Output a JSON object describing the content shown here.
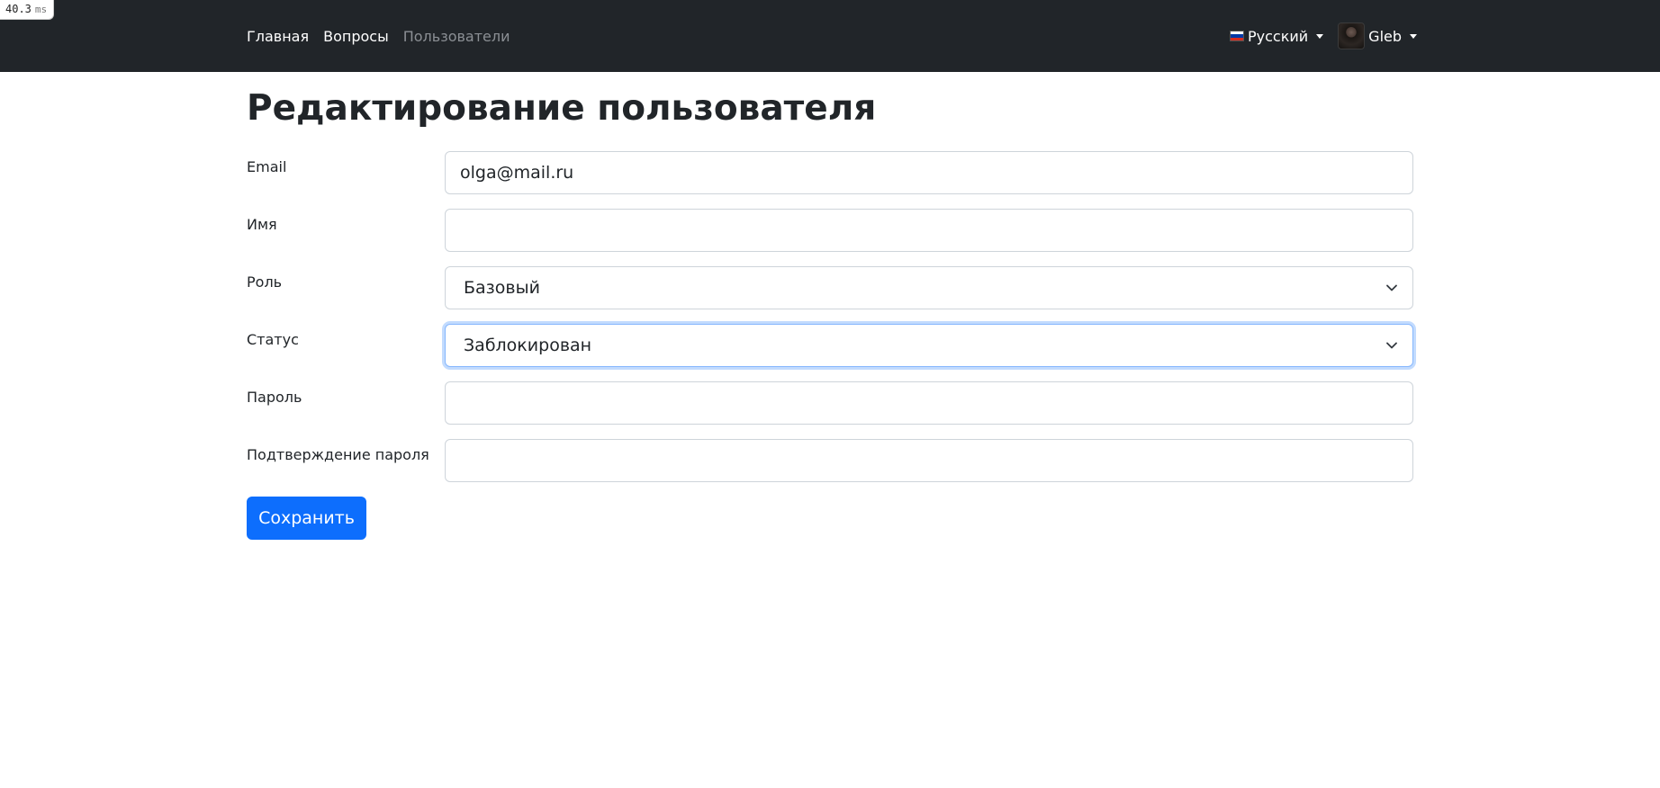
{
  "perf_badge": {
    "value": "40.3",
    "unit": "ms"
  },
  "navbar": {
    "links": [
      {
        "label": "Главная",
        "active": true
      },
      {
        "label": "Вопросы",
        "active": true
      },
      {
        "label": "Пользователи",
        "active": false
      }
    ],
    "language": {
      "label": "Русский",
      "flag_icon": "russia-flag-icon"
    },
    "user": {
      "name": "Gleb",
      "avatar_icon": "user-avatar"
    }
  },
  "page": {
    "title": "Редактирование пользователя"
  },
  "form": {
    "email": {
      "label": "Email",
      "value": "olga@mail.ru"
    },
    "name": {
      "label": "Имя",
      "value": ""
    },
    "role": {
      "label": "Роль",
      "selected": "Базовый"
    },
    "status": {
      "label": "Статус",
      "selected": "Заблокирован"
    },
    "password": {
      "label": "Пароль",
      "value": ""
    },
    "password_confirm": {
      "label": "Подтверждение пароля",
      "value": ""
    },
    "submit_label": "Сохранить"
  },
  "colors": {
    "navbar_bg": "#212529",
    "primary": "#0d6efd",
    "focus_border": "#86b7fe",
    "muted_link": "#8b8f94"
  }
}
